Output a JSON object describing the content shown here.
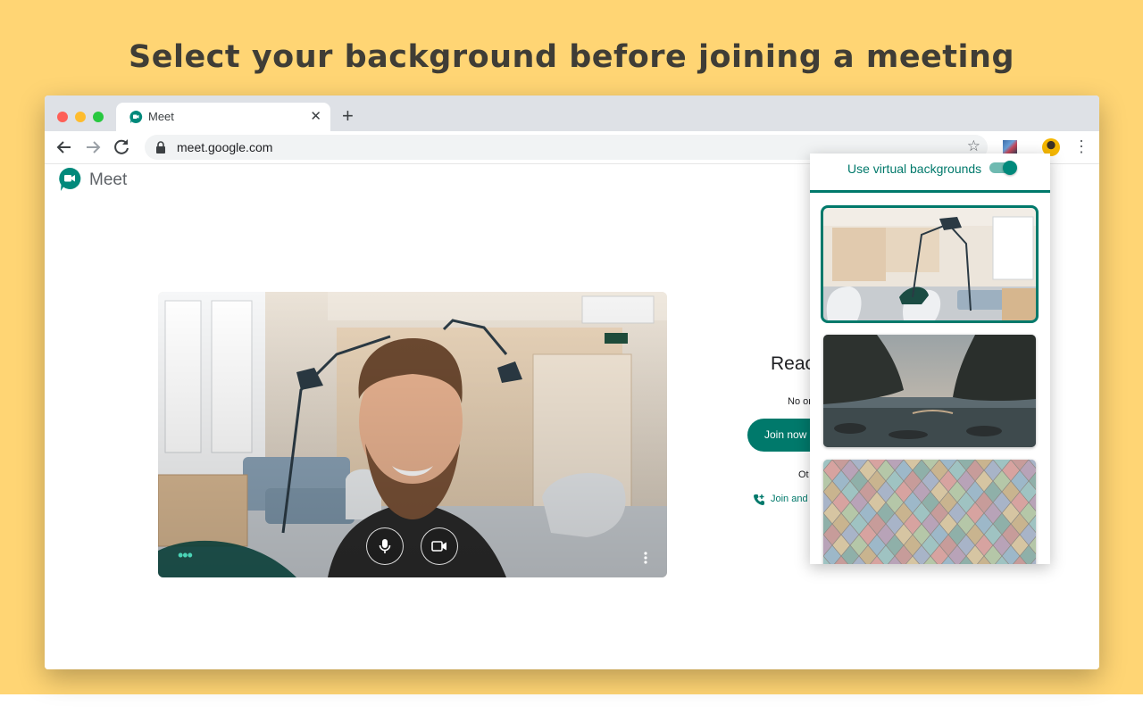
{
  "banner": {
    "headline": "Select your background before joining a meeting"
  },
  "browser": {
    "tab": {
      "title": "Meet",
      "close": "✕"
    },
    "new_tab": "+",
    "url": "meet.google.com",
    "star": "☆",
    "menu": "⋮"
  },
  "meet": {
    "wordmark": "Meet",
    "ready_title": "Reac",
    "ready_subtitle": "No or",
    "join_now": "Join now",
    "other_options": "Ot",
    "join_phone": "Join and"
  },
  "preview": {
    "more_options": "•••"
  },
  "panel": {
    "title": "Use virtual backgrounds",
    "toggle_on": true,
    "backgrounds": [
      "office",
      "sea-rocks",
      "colored-tiles"
    ],
    "selected_index": 0
  },
  "colors": {
    "banner": "#ffd574",
    "accent": "#00796b",
    "headline": "#3f3d36"
  },
  "icons": [
    "meet-logo-icon",
    "back-arrow-icon",
    "forward-arrow-icon",
    "reload-icon",
    "lock-icon",
    "star-icon",
    "extension-icon",
    "profile-avatar-icon",
    "more-vert-icon",
    "mic-icon",
    "camera-icon",
    "phone-icon"
  ]
}
